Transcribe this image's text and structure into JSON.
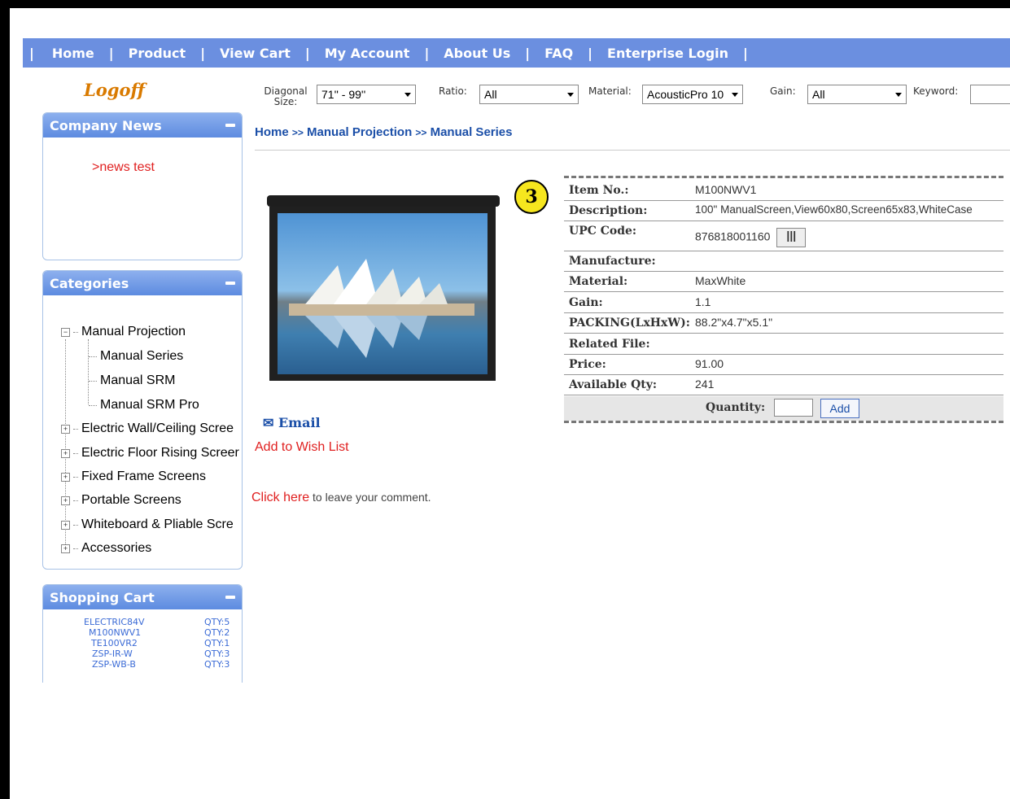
{
  "nav": {
    "items": [
      "Home",
      "Product",
      "View Cart",
      "My Account",
      "About Us",
      "FAQ",
      "Enterprise Login"
    ],
    "separator": "|"
  },
  "logoff": "Logoff",
  "filters": {
    "diagonal_label_1": "Diagonal",
    "diagonal_label_2": "Size:",
    "diagonal_value": "71'' - 99''",
    "ratio_label": "Ratio:",
    "ratio_value": "All",
    "material_label": "Material:",
    "material_value": "AcousticPro 10",
    "gain_label": "Gain:",
    "gain_value": "All",
    "keyword_label": "Keyword:",
    "keyword_value": ""
  },
  "company_news": {
    "title": "Company News",
    "items": [
      ">news test"
    ]
  },
  "categories": {
    "title": "Categories",
    "items": [
      {
        "label": "Manual Projection",
        "expanded": true,
        "level": 0
      },
      {
        "label": "Manual Series",
        "level": 1
      },
      {
        "label": "Manual SRM",
        "level": 1
      },
      {
        "label": "Manual SRM Pro",
        "level": 1
      },
      {
        "label": "Electric Wall/Ceiling Scree",
        "level": 0
      },
      {
        "label": "Electric Floor Rising Screer",
        "level": 0
      },
      {
        "label": "Fixed Frame Screens",
        "level": 0
      },
      {
        "label": "Portable Screens",
        "level": 0
      },
      {
        "label": "Whiteboard & Pliable Scre",
        "level": 0
      },
      {
        "label": "Accessories",
        "level": 0
      }
    ]
  },
  "cart": {
    "title": "Shopping Cart",
    "items": [
      {
        "sku": "ELECTRIC84V",
        "qty": "QTY:5"
      },
      {
        "sku": "M100NWV1",
        "qty": "QTY:2"
      },
      {
        "sku": "TE100VR2",
        "qty": "QTY:1"
      },
      {
        "sku": "ZSP-IR-W",
        "qty": "QTY:3"
      },
      {
        "sku": "ZSP-WB-B",
        "qty": "QTY:3"
      }
    ]
  },
  "breadcrumb": {
    "home": "Home",
    "sep": ">>",
    "level1": "Manual Projection",
    "level2": "Manual Series"
  },
  "product": {
    "badge": "3",
    "email": "Email",
    "wish": "Add to Wish List",
    "comment_link": "Click here",
    "comment_text": " to leave your comment.",
    "details": [
      {
        "label": "Item No.:",
        "value": "M100NWV1"
      },
      {
        "label": "Description:",
        "value": "100\" ManualScreen,View60x80,Screen65x83,WhiteCase"
      },
      {
        "label": "UPC Code:",
        "value": "876818001160"
      },
      {
        "label": "Manufacture:",
        "value": ""
      },
      {
        "label": "Material:",
        "value": "MaxWhite"
      },
      {
        "label": "Gain:",
        "value": "1.1"
      },
      {
        "label": "PACKING(LxHxW):",
        "value": "88.2\"x4.7\"x5.1\""
      },
      {
        "label": "Related File:",
        "value": ""
      },
      {
        "label": "Price:",
        "value": "91.00"
      },
      {
        "label": "Available Qty:",
        "value": "241"
      }
    ],
    "quantity_label": "Quantity:",
    "add_label": "Add",
    "upc_button": "|||"
  },
  "colors": {
    "nav": "#6b8fe0",
    "link": "#1b4fa8",
    "red": "#e02020",
    "logoff": "#d97a00"
  }
}
